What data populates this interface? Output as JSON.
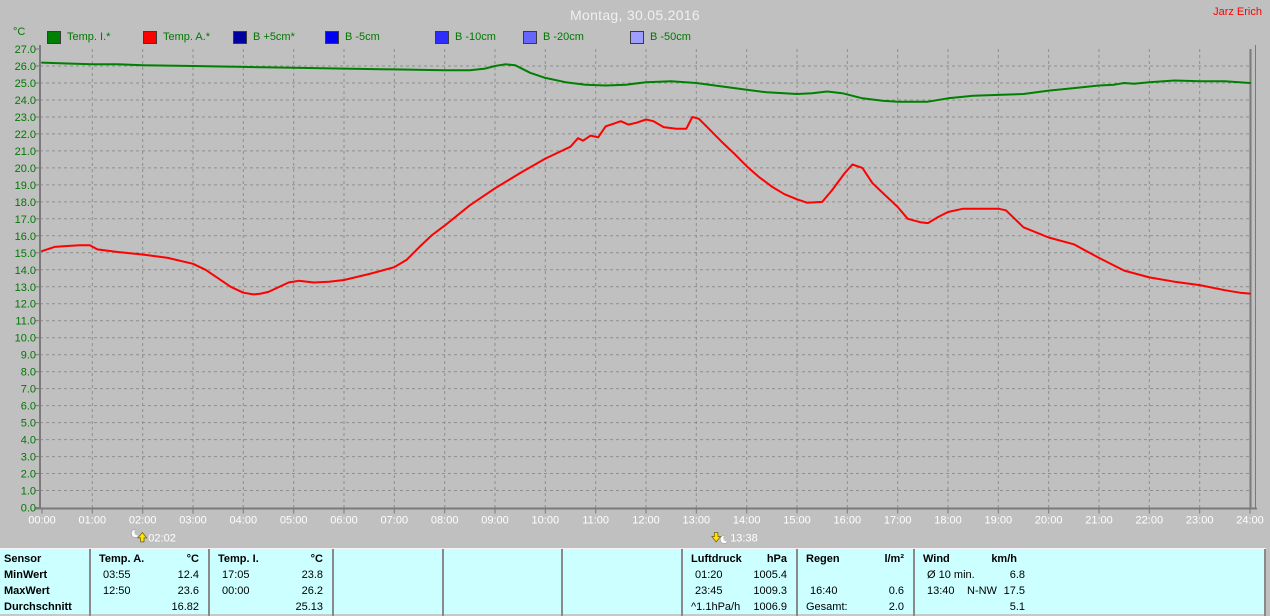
{
  "header": {
    "title": "Montag, 30.05.2016",
    "author": "Jarz Erich"
  },
  "legend": {
    "unit": "°C",
    "items": [
      {
        "label": "Temp. I.*",
        "color": "#008000"
      },
      {
        "label": "Temp. A.*",
        "color": "#ff0000"
      },
      {
        "label": "B +5cm*",
        "color": "#0000a0"
      },
      {
        "label": "B -5cm",
        "color": "#0000f4"
      },
      {
        "label": "B -10cm",
        "color": "#2d2dff"
      },
      {
        "label": "B -20cm",
        "color": "#6666ff"
      },
      {
        "label": "B -50cm",
        "color": "#9e9eff"
      }
    ]
  },
  "chart_data": {
    "type": "line",
    "title": "Montag, 30.05.2016",
    "xlabel": "",
    "ylabel": "°C",
    "ylim": [
      0.0,
      27.0
    ],
    "y_tick_step": 1.0,
    "xlim_hours": [
      0,
      24
    ],
    "grid": true,
    "x_tick_labels": [
      "00:00",
      "01:00",
      "02:00",
      "03:00",
      "04:00",
      "05:00",
      "06:00",
      "07:00",
      "08:00",
      "09:00",
      "10:00",
      "11:00",
      "12:00",
      "13:00",
      "14:00",
      "15:00",
      "16:00",
      "17:00",
      "18:00",
      "19:00",
      "20:00",
      "21:00",
      "22:00",
      "23:00",
      "24:00"
    ],
    "series": [
      {
        "name": "Temp. I.*",
        "color": "#008000",
        "points": [
          [
            0,
            26.2
          ],
          [
            0.5,
            26.15
          ],
          [
            1,
            26.1
          ],
          [
            1.5,
            26.1
          ],
          [
            2,
            26.05
          ],
          [
            3,
            26.0
          ],
          [
            4,
            25.95
          ],
          [
            5,
            25.9
          ],
          [
            6,
            25.85
          ],
          [
            7,
            25.8
          ],
          [
            8,
            25.75
          ],
          [
            8.5,
            25.75
          ],
          [
            8.8,
            25.85
          ],
          [
            9,
            26.0
          ],
          [
            9.2,
            26.1
          ],
          [
            9.4,
            26.05
          ],
          [
            9.7,
            25.6
          ],
          [
            10,
            25.3
          ],
          [
            10.4,
            25.05
          ],
          [
            10.8,
            24.9
          ],
          [
            11.2,
            24.85
          ],
          [
            11.6,
            24.9
          ],
          [
            12,
            25.05
          ],
          [
            12.5,
            25.1
          ],
          [
            13,
            25.0
          ],
          [
            13.5,
            24.8
          ],
          [
            14,
            24.6
          ],
          [
            14.4,
            24.45
          ],
          [
            15,
            24.35
          ],
          [
            15.3,
            24.4
          ],
          [
            15.6,
            24.5
          ],
          [
            15.9,
            24.4
          ],
          [
            16.3,
            24.1
          ],
          [
            16.7,
            23.95
          ],
          [
            17,
            23.9
          ],
          [
            17.6,
            23.9
          ],
          [
            18,
            24.1
          ],
          [
            18.5,
            24.25
          ],
          [
            19,
            24.3
          ],
          [
            19.5,
            24.35
          ],
          [
            20,
            24.55
          ],
          [
            20.5,
            24.7
          ],
          [
            21,
            24.85
          ],
          [
            21.3,
            24.9
          ],
          [
            21.5,
            25.0
          ],
          [
            21.7,
            24.95
          ],
          [
            22,
            25.05
          ],
          [
            22.5,
            25.15
          ],
          [
            23,
            25.1
          ],
          [
            23.5,
            25.1
          ],
          [
            24,
            25.0
          ]
        ]
      },
      {
        "name": "Temp. A.*",
        "color": "#ff0000",
        "points": [
          [
            0,
            15.1
          ],
          [
            0.25,
            15.35
          ],
          [
            0.5,
            15.4
          ],
          [
            0.75,
            15.45
          ],
          [
            0.95,
            15.45
          ],
          [
            1.1,
            15.2
          ],
          [
            1.5,
            15.05
          ],
          [
            2,
            14.9
          ],
          [
            2.5,
            14.7
          ],
          [
            3,
            14.35
          ],
          [
            3.25,
            14.0
          ],
          [
            3.5,
            13.5
          ],
          [
            3.75,
            13.0
          ],
          [
            4,
            12.65
          ],
          [
            4.2,
            12.55
          ],
          [
            4.35,
            12.6
          ],
          [
            4.5,
            12.7
          ],
          [
            4.9,
            13.25
          ],
          [
            5.1,
            13.35
          ],
          [
            5.4,
            13.25
          ],
          [
            5.7,
            13.3
          ],
          [
            6,
            13.4
          ],
          [
            6.5,
            13.75
          ],
          [
            7,
            14.15
          ],
          [
            7.25,
            14.6
          ],
          [
            7.5,
            15.35
          ],
          [
            7.75,
            16.05
          ],
          [
            8,
            16.6
          ],
          [
            8.5,
            17.8
          ],
          [
            9,
            18.8
          ],
          [
            9.5,
            19.7
          ],
          [
            10,
            20.55
          ],
          [
            10.5,
            21.25
          ],
          [
            10.65,
            21.75
          ],
          [
            10.75,
            21.6
          ],
          [
            10.9,
            21.9
          ],
          [
            11.05,
            21.8
          ],
          [
            11.2,
            22.45
          ],
          [
            11.35,
            22.6
          ],
          [
            11.5,
            22.75
          ],
          [
            11.65,
            22.55
          ],
          [
            11.8,
            22.65
          ],
          [
            12,
            22.85
          ],
          [
            12.15,
            22.75
          ],
          [
            12.35,
            22.4
          ],
          [
            12.6,
            22.3
          ],
          [
            12.8,
            22.3
          ],
          [
            12.92,
            23.0
          ],
          [
            13.05,
            22.9
          ],
          [
            13.25,
            22.3
          ],
          [
            13.5,
            21.55
          ],
          [
            13.75,
            20.85
          ],
          [
            14,
            20.1
          ],
          [
            14.25,
            19.45
          ],
          [
            14.5,
            18.9
          ],
          [
            14.75,
            18.45
          ],
          [
            15,
            18.15
          ],
          [
            15.2,
            17.95
          ],
          [
            15.5,
            18.0
          ],
          [
            15.7,
            18.7
          ],
          [
            15.95,
            19.7
          ],
          [
            16.1,
            20.2
          ],
          [
            16.3,
            20.0
          ],
          [
            16.5,
            19.1
          ],
          [
            16.75,
            18.4
          ],
          [
            17,
            17.7
          ],
          [
            17.2,
            17.0
          ],
          [
            17.45,
            16.8
          ],
          [
            17.6,
            16.75
          ],
          [
            17.8,
            17.1
          ],
          [
            18,
            17.4
          ],
          [
            18.3,
            17.6
          ],
          [
            18.6,
            17.6
          ],
          [
            19,
            17.6
          ],
          [
            19.15,
            17.5
          ],
          [
            19.5,
            16.5
          ],
          [
            20,
            15.9
          ],
          [
            20.5,
            15.5
          ],
          [
            21,
            14.7
          ],
          [
            21.5,
            13.95
          ],
          [
            22,
            13.55
          ],
          [
            22.5,
            13.3
          ],
          [
            23,
            13.1
          ],
          [
            23.5,
            12.8
          ],
          [
            23.8,
            12.65
          ],
          [
            24,
            12.6
          ]
        ]
      }
    ],
    "markers": [
      {
        "label": "02:02",
        "hour": 2.033,
        "type": "moonrise"
      },
      {
        "label": "13:38",
        "hour": 13.633,
        "type": "moonset"
      }
    ]
  },
  "table": {
    "columns": [
      {
        "type": "labels",
        "rows": [
          "Sensor",
          "MinWert",
          "MaxWert",
          "Durchschnitt"
        ]
      },
      {
        "type": "data",
        "title": "Temp. A.",
        "unit": "°C",
        "rows": [
          [
            "03:55",
            "12.4"
          ],
          [
            "12:50",
            "23.6"
          ],
          [
            "",
            "16.82"
          ]
        ]
      },
      {
        "type": "data",
        "title": "Temp. I.",
        "unit": "°C",
        "rows": [
          [
            "17:05",
            "23.8"
          ],
          [
            "00:00",
            "26.2"
          ],
          [
            "",
            "25.13"
          ]
        ]
      },
      {
        "type": "empty"
      },
      {
        "type": "empty"
      },
      {
        "type": "empty"
      },
      {
        "type": "data",
        "title": "Luftdruck",
        "unit": "hPa",
        "rows": [
          [
            "01:20",
            "1005.4"
          ],
          [
            "23:45",
            "1009.3"
          ],
          [
            "^1.1hPa/h",
            "1006.9"
          ]
        ]
      },
      {
        "type": "data",
        "title": "Regen",
        "unit": "l/m²",
        "rows": [
          [
            "",
            ""
          ],
          [
            "16:40",
            "0.6"
          ],
          [
            "Gesamt:",
            "2.0"
          ]
        ]
      },
      {
        "type": "wind",
        "title": "Wind",
        "unit": "km/h",
        "rows": [
          [
            "Ø 10 min.",
            "",
            "6.8"
          ],
          [
            "13:40",
            "N-NW",
            "17.5"
          ],
          [
            "",
            "",
            "5.1"
          ]
        ]
      }
    ]
  }
}
